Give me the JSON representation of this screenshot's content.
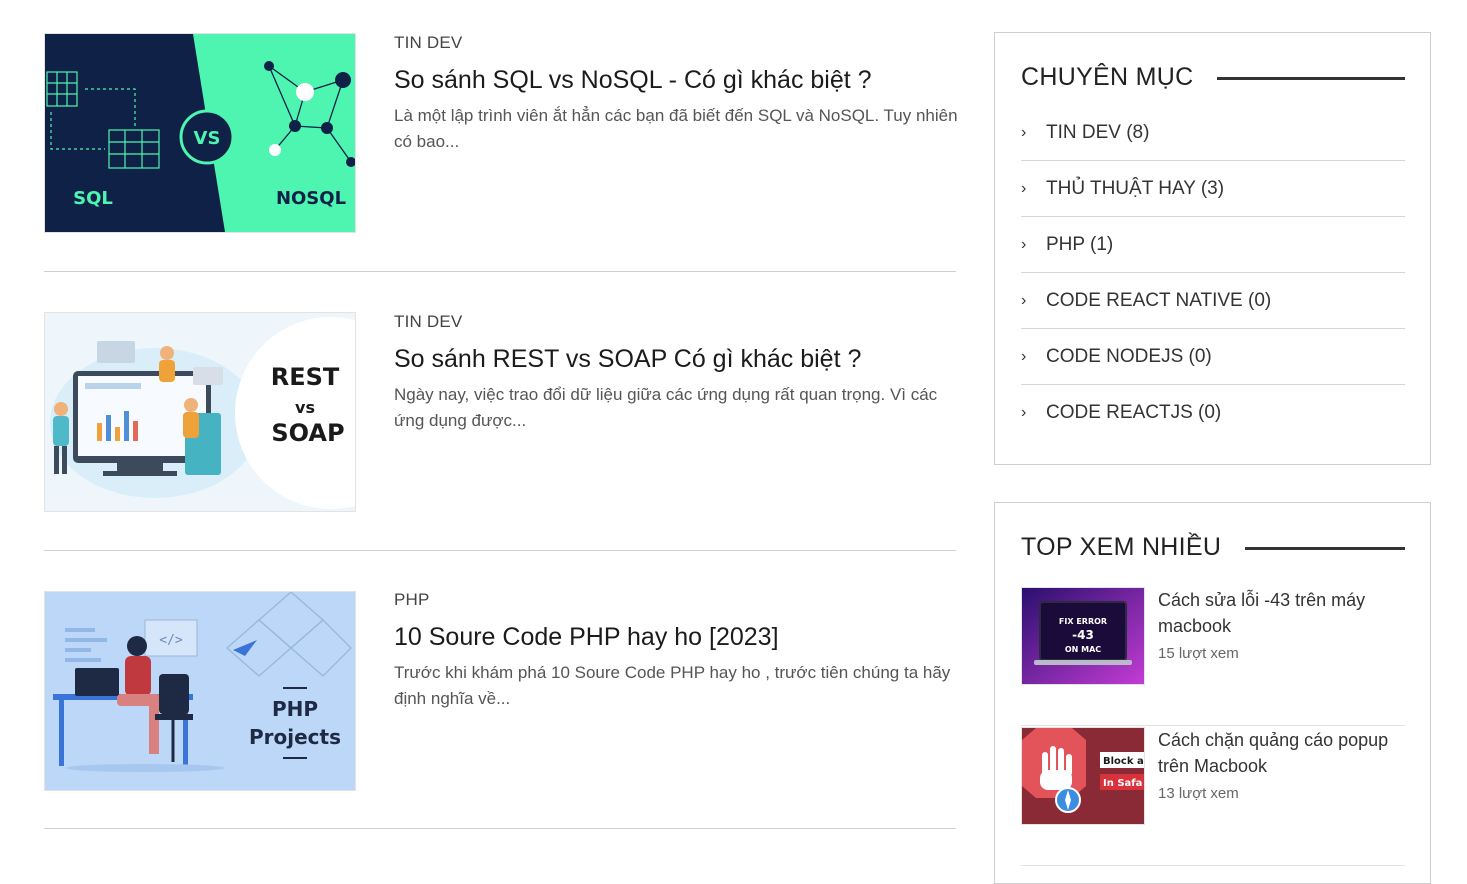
{
  "posts": [
    {
      "category": "TIN DEV",
      "title": "So sánh SQL vs NoSQL - Có gì khác biệt ?",
      "excerpt": "Là một lập trình viên ắt hẳn các bạn đã biết đến SQL và NoSQL. Tuy nhiên có bao...",
      "thumb_text": [
        "SQL",
        "VS",
        "NOSQL"
      ]
    },
    {
      "category": "TIN DEV",
      "title": "So sánh REST vs SOAP Có gì khác biệt ?",
      "excerpt": "Ngày nay, việc trao đổi dữ liệu giữa các ứng dụng rất quan trọng. Vì các ứng dụng được...",
      "thumb_text": [
        "REST",
        "vs",
        "SOAP"
      ]
    },
    {
      "category": "PHP",
      "title": "10 Soure Code PHP hay ho [2023]",
      "excerpt": "Trước khi khám phá 10 Soure Code PHP hay ho , trước tiên chúng ta hãy định nghĩa về...",
      "thumb_text": [
        "PHP",
        "Projects",
        "</>"
      ]
    }
  ],
  "sidebar": {
    "categories": {
      "title": "CHUYÊN MỤC",
      "items": [
        {
          "label": "TIN DEV (8)"
        },
        {
          "label": "THỦ THUẬT HAY (3)"
        },
        {
          "label": "PHP (1)"
        },
        {
          "label": "CODE REACT NATIVE (0)"
        },
        {
          "label": "CODE NODEJS (0)"
        },
        {
          "label": "CODE REACTJS (0)"
        }
      ]
    },
    "top_viewed": {
      "title": "TOP XEM NHIỀU",
      "items": [
        {
          "title": "Cách sửa lỗi -43 trên máy macbook",
          "views": "15 lượt xem",
          "thumb_text": [
            "FIX ERROR",
            "-43",
            "ON MAC"
          ]
        },
        {
          "title": "Cách chặn quảng cáo popup trên Macbook",
          "views": "13 lượt xem",
          "thumb_text": [
            "Block a",
            "In Safa"
          ]
        }
      ]
    }
  },
  "colors": {
    "sql_dark": "#0f2147",
    "sql_green": "#4df5b0",
    "php_bg": "#bcd7f7",
    "mac_purple": "#5a2fb8",
    "block_red": "#e2545a"
  }
}
